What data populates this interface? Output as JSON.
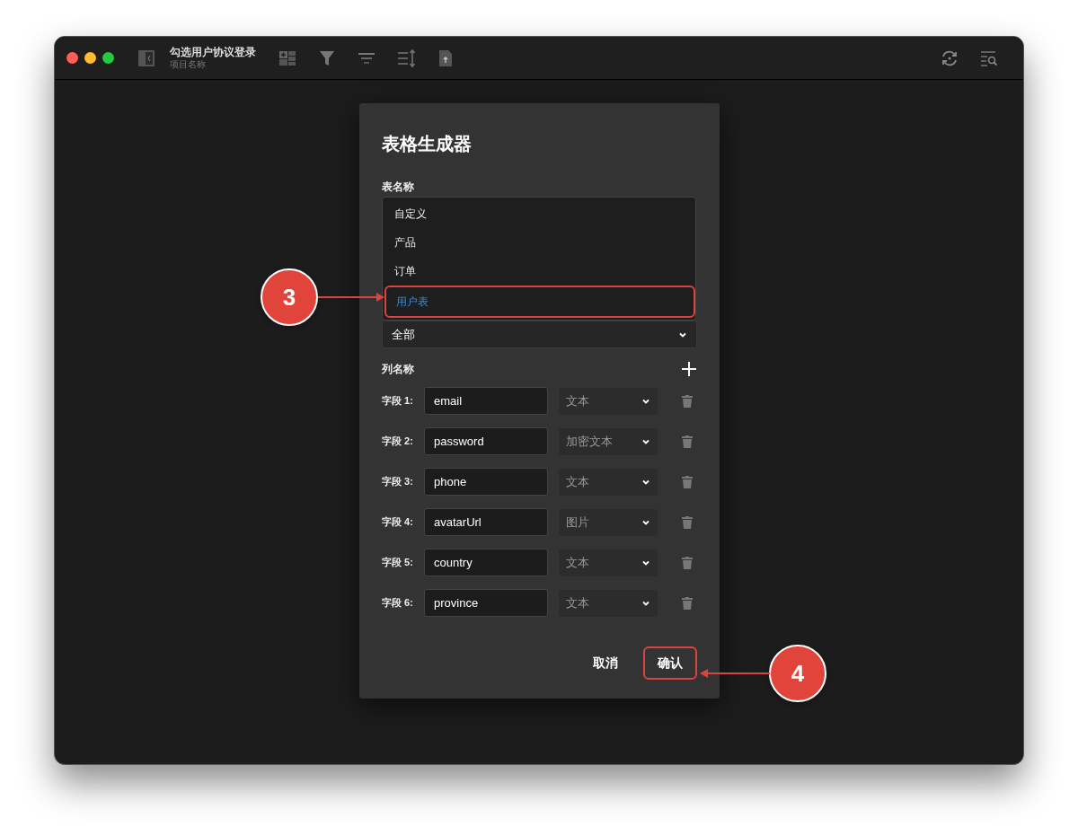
{
  "window": {
    "title": "勾选用户协议登录",
    "subtitle": "项目名称"
  },
  "dialog": {
    "title": "表格生成器",
    "table_name_label": "表名称",
    "table_options": [
      {
        "label": "自定义",
        "selected": false
      },
      {
        "label": "产品",
        "selected": false
      },
      {
        "label": "订单",
        "selected": false
      },
      {
        "label": "用户表",
        "selected": true
      }
    ],
    "preset_select": {
      "value": "全部"
    },
    "columns_label": "列名称",
    "fields": [
      {
        "label": "字段 1:",
        "name": "email",
        "type": "文本"
      },
      {
        "label": "字段 2:",
        "name": "password",
        "type": "加密文本"
      },
      {
        "label": "字段 3:",
        "name": "phone",
        "type": "文本"
      },
      {
        "label": "字段 4:",
        "name": "avatarUrl",
        "type": "图片"
      },
      {
        "label": "字段 5:",
        "name": "country",
        "type": "文本"
      },
      {
        "label": "字段 6:",
        "name": "province",
        "type": "文本"
      }
    ],
    "buttons": [
      {
        "label": "取消",
        "kind": "secondary"
      },
      {
        "label": "确认",
        "kind": "primary"
      }
    ]
  },
  "annotations": [
    {
      "label": "3"
    },
    {
      "label": "4"
    }
  ]
}
